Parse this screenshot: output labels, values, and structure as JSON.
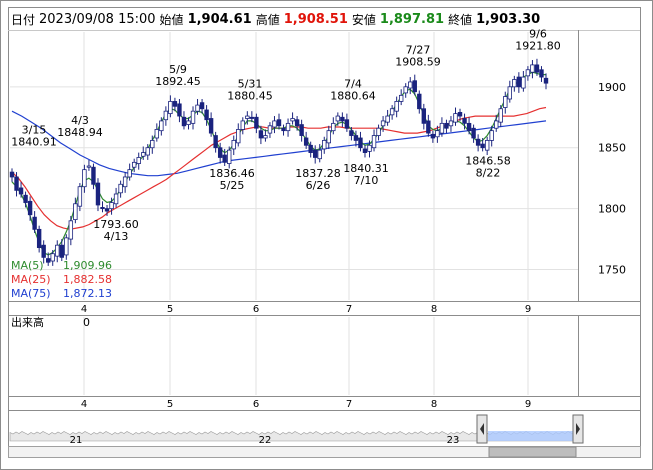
{
  "header": {
    "date_label": "日付",
    "datetime": "2023/09/08 15:00",
    "open_label": "始値",
    "open": "1,904.61",
    "high_label": "高値",
    "high": "1,908.51",
    "low_label": "安値",
    "low": "1,897.81",
    "close_label": "終値",
    "close": "1,903.30"
  },
  "colors": {
    "high": "#e0140a",
    "low": "#1a8a1a",
    "candle": "#1a237e",
    "ma5": "#2e8b2e",
    "ma25": "#e53030",
    "ma75": "#2040d0",
    "volume_fill": "#aac8ff"
  },
  "ma_legend": [
    {
      "label": "MA(5)",
      "value": "1,909.96",
      "color": "#2e8b2e"
    },
    {
      "label": "MA(25)",
      "value": "1,882.58",
      "color": "#e53030"
    },
    {
      "label": "MA(75)",
      "value": "1,872.13",
      "color": "#2040d0"
    }
  ],
  "volume_panel": {
    "label": "出来高",
    "value": "0"
  },
  "navigator": {
    "labels": [
      "21",
      "22",
      "23"
    ]
  },
  "chart_data": {
    "type": "candlestick",
    "y_ticks": [
      1750,
      1800,
      1850,
      1900
    ],
    "ylim": [
      1725,
      1945
    ],
    "x_month_labels": [
      "4",
      "5",
      "6",
      "7",
      "8",
      "9"
    ],
    "annotations": [
      {
        "date": "3/15",
        "value": "1840.91",
        "kind": "high"
      },
      {
        "date": "4/3",
        "value": "1848.94",
        "kind": "high"
      },
      {
        "date": "4/13",
        "value": "1793.60",
        "kind": "low"
      },
      {
        "date": "5/9",
        "value": "1892.45",
        "kind": "high"
      },
      {
        "date": "5/25",
        "value": "1836.46",
        "kind": "low"
      },
      {
        "date": "5/31",
        "value": "1880.45",
        "kind": "high"
      },
      {
        "date": "6/26",
        "value": "1837.28",
        "kind": "low"
      },
      {
        "date": "7/4",
        "value": "1880.64",
        "kind": "high"
      },
      {
        "date": "7/10",
        "value": "1840.31",
        "kind": "low"
      },
      {
        "date": "7/27",
        "value": "1908.59",
        "kind": "high"
      },
      {
        "date": "8/22",
        "value": "1846.58",
        "kind": "low"
      },
      {
        "date": "9/6",
        "value": "1921.80",
        "kind": "high"
      }
    ],
    "close_path": [
      1826,
      1815,
      1812,
      1805,
      1795,
      1783,
      1768,
      1760,
      1756,
      1763,
      1770,
      1760,
      1776,
      1790,
      1804,
      1818,
      1832,
      1835,
      1820,
      1803,
      1800,
      1798,
      1805,
      1812,
      1820,
      1826,
      1832,
      1838,
      1842,
      1846,
      1850,
      1856,
      1865,
      1872,
      1880,
      1888,
      1884,
      1876,
      1868,
      1872,
      1880,
      1885,
      1882,
      1873,
      1862,
      1850,
      1842,
      1838,
      1848,
      1856,
      1865,
      1872,
      1876,
      1874,
      1866,
      1858,
      1860,
      1868,
      1872,
      1868,
      1864,
      1870,
      1874,
      1868,
      1860,
      1852,
      1846,
      1842,
      1848,
      1856,
      1864,
      1870,
      1876,
      1872,
      1866,
      1860,
      1856,
      1850,
      1846,
      1852,
      1860,
      1866,
      1872,
      1876,
      1882,
      1888,
      1893,
      1900,
      1904,
      1896,
      1882,
      1870,
      1862,
      1858,
      1864,
      1870,
      1866,
      1872,
      1878,
      1876,
      1870,
      1864,
      1858,
      1852,
      1850,
      1856,
      1864,
      1872,
      1882,
      1892,
      1900,
      1906,
      1900,
      1908,
      1914,
      1918,
      1912,
      1908,
      1903
    ],
    "ma5_path": [
      1822,
      1818,
      1812,
      1804,
      1794,
      1782,
      1772,
      1764,
      1762,
      1764,
      1768,
      1773,
      1781,
      1790,
      1803,
      1815,
      1823,
      1825,
      1822,
      1815,
      1808,
      1805,
      1806,
      1810,
      1816,
      1822,
      1828,
      1834,
      1839,
      1843,
      1849,
      1856,
      1863,
      1871,
      1878,
      1882,
      1881,
      1877,
      1874,
      1874,
      1877,
      1880,
      1879,
      1873,
      1865,
      1856,
      1849,
      1846,
      1848,
      1853,
      1860,
      1867,
      1872,
      1872,
      1870,
      1866,
      1864,
      1864,
      1866,
      1866,
      1866,
      1868,
      1868,
      1866,
      1862,
      1857,
      1851,
      1848,
      1849,
      1854,
      1860,
      1866,
      1870,
      1871,
      1869,
      1865,
      1860,
      1855,
      1852,
      1853,
      1857,
      1862,
      1868,
      1874,
      1880,
      1886,
      1892,
      1897,
      1898,
      1894,
      1886,
      1877,
      1868,
      1865,
      1864,
      1866,
      1868,
      1870,
      1872,
      1871,
      1868,
      1863,
      1858,
      1855,
      1856,
      1860,
      1866,
      1874,
      1882,
      1890,
      1898,
      1902,
      1904,
      1908,
      1910,
      1912,
      1911,
      1910,
      1910
    ],
    "ma25_path": [
      1830,
      1825,
      1818,
      1810,
      1802,
      1795,
      1790,
      1786,
      1784,
      1783,
      1784,
      1785,
      1787,
      1790,
      1793,
      1797,
      1800,
      1803,
      1806,
      1809,
      1812,
      1815,
      1818,
      1821,
      1824,
      1828,
      1832,
      1836,
      1840,
      1844,
      1848,
      1852,
      1855,
      1858,
      1861,
      1863,
      1865,
      1866,
      1867,
      1867,
      1866,
      1866,
      1866,
      1867,
      1867,
      1867,
      1866,
      1866,
      1866,
      1867,
      1867,
      1867,
      1866,
      1866,
      1866,
      1866,
      1866,
      1866,
      1865,
      1864,
      1863,
      1862,
      1862,
      1862,
      1863,
      1864,
      1866,
      1868,
      1870,
      1872,
      1874,
      1875,
      1876,
      1876,
      1876,
      1876,
      1876,
      1876,
      1876,
      1877,
      1878,
      1880,
      1882,
      1883
    ],
    "ma75_path": [
      1880,
      1876,
      1871,
      1866,
      1860,
      1854,
      1849,
      1844,
      1840,
      1836,
      1833,
      1831,
      1829,
      1828,
      1827,
      1827,
      1828,
      1829,
      1831,
      1833,
      1835,
      1837,
      1839,
      1840,
      1841,
      1842,
      1843,
      1844,
      1845,
      1846,
      1847,
      1848,
      1849,
      1850,
      1851,
      1852,
      1853,
      1854,
      1855,
      1856,
      1857,
      1858,
      1859,
      1860,
      1861,
      1862,
      1863,
      1864,
      1865,
      1866,
      1867,
      1868,
      1869,
      1870,
      1871,
      1872
    ]
  }
}
